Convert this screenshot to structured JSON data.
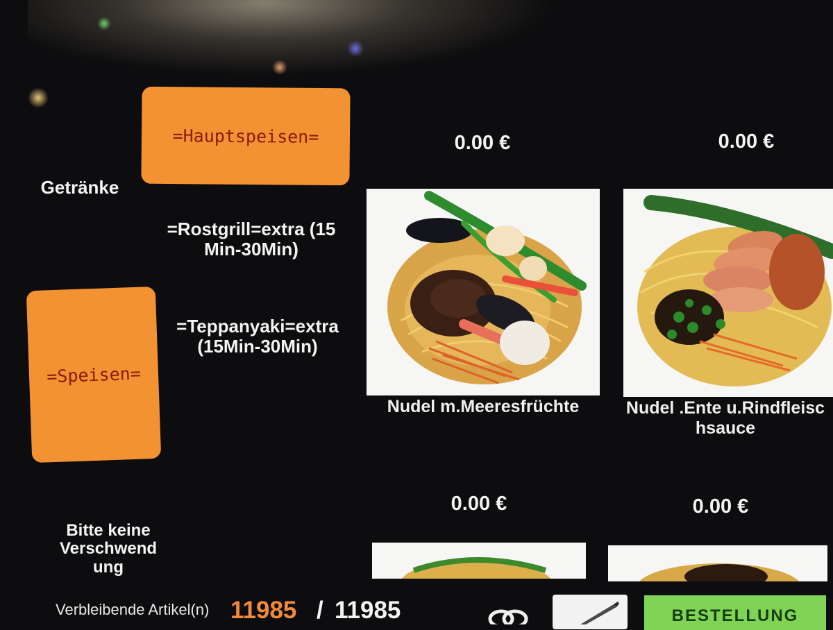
{
  "categories": {
    "drinks": "Getränke",
    "main_courses": "=Hauptspeisen=",
    "grill": "=Rostgrill=extra (15 Min-30Min)",
    "grill_line1": "=Rostgrill=extra (15",
    "grill_line2": "Min-30Min)",
    "teppanyaki_line1": "=Teppanyaki=extra",
    "teppanyaki_line2": "(15Min-30Min)",
    "dishes": "=Speisen=",
    "notice_line1": "Bitte keine",
    "notice_line2": "Verschwend",
    "notice_line3": "ung"
  },
  "products": [
    {
      "price": "0.00 €",
      "name_line1": "Nudel m.Meeresfrüchte",
      "name_line2": "",
      "image": "noodles-seafood-photo"
    },
    {
      "price": "0.00 €",
      "name_line1": "Nudel .Ente u.Rindfleisc",
      "name_line2": "hsauce",
      "image": "noodles-duck-beef-photo"
    },
    {
      "price": "0.00 €",
      "name_line1": "",
      "name_line2": "",
      "image": "noodles-photo"
    },
    {
      "price": "0.00 €",
      "name_line1": "",
      "name_line2": "",
      "image": "noodles-photo"
    }
  ],
  "footer": {
    "remaining_label": "Verbleibende Artikel(n)",
    "remaining_now": "11985",
    "separator": "/",
    "remaining_total": "11985",
    "order_label": "BESTELLUNG"
  },
  "colors": {
    "accent_orange": "#f39232",
    "order_green": "#7fd456",
    "background": "#0d0c0e"
  }
}
